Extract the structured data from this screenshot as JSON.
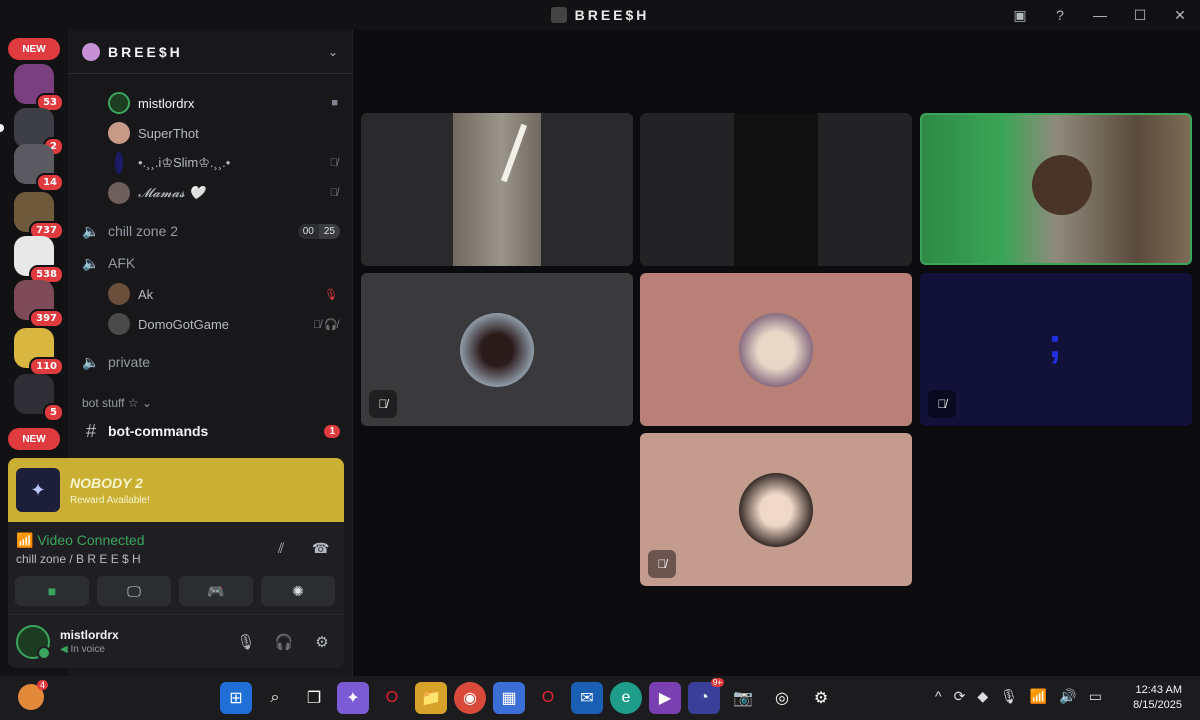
{
  "window": {
    "title": "BREE$H",
    "controls": [
      "inbox-icon",
      "help-icon",
      "minimize-icon",
      "maximize-icon",
      "close-icon"
    ]
  },
  "servers": [
    {
      "badge": "53",
      "color": "#7a3f7f"
    },
    {
      "badge": "2",
      "color": "#3e3e46"
    },
    {
      "badge": "14",
      "color": "#5a5a60"
    },
    {
      "badge": "737",
      "color": "#6e5a3a"
    },
    {
      "badge": "538",
      "color": "#e8e8e8"
    },
    {
      "badge": "397",
      "color": "#7e4a58"
    },
    {
      "badge": "110",
      "color": "#d9b640"
    },
    {
      "badge": "5",
      "color": "#2e2e34"
    }
  ],
  "new_label": "NEW",
  "guild": {
    "name": "BREE$H"
  },
  "voice_users_top": [
    {
      "name": "mistlordrx",
      "status": "camera-icon",
      "color": "#1c3d22"
    },
    {
      "name": "SuperThot",
      "status": "",
      "color": "#c79a87"
    },
    {
      "name": "•.¸¸.i♔Slim♔.¸¸.•",
      "status": "mic-off-icon",
      "color": "#1a1a66"
    },
    {
      "name": "𝓜𝓪𝓶𝓪𝓼 🤍",
      "status": "mic-off-icon",
      "color": "#6e5e5c"
    }
  ],
  "channels": {
    "chill_zone_2": {
      "name": "chill zone 2",
      "count_current": "00",
      "count_limit": "25"
    },
    "afk": {
      "name": "AFK"
    },
    "afk_users": [
      {
        "name": "Ak",
        "status": "mic-muted-red-icon",
        "color": "#6a4e3a"
      },
      {
        "name": "DomoGotGame",
        "status": "deafened-icon",
        "color": "#4a4a4a"
      }
    ],
    "private": {
      "name": "private"
    },
    "category": "bot stuff ☆ ⌄",
    "bot_commands": {
      "name": "bot-commands",
      "unread": "1"
    }
  },
  "reward": {
    "title": "NOBODY 2",
    "subtitle": "Reward Available!"
  },
  "voice_panel": {
    "status": "Video Connected",
    "location": "chill zone / B R E E $ H",
    "buttons": [
      "camera",
      "screen-share",
      "activity",
      "soundboard"
    ]
  },
  "user": {
    "name": "mistlordrx",
    "status": "In voice"
  },
  "tiles": [
    {
      "kind": "video-dark",
      "color": "#2a2a2c"
    },
    {
      "kind": "video-dark",
      "color": "#232325"
    },
    {
      "kind": "video-live",
      "color": "#5f8a55"
    },
    {
      "kind": "avatar",
      "color": "#3a3a3c",
      "avatar_color": "#4a4a52",
      "muted": true
    },
    {
      "kind": "avatar",
      "color": "#b98077",
      "avatar_color": "#a8776a",
      "muted": false
    },
    {
      "kind": "avatar",
      "color": "#11113a",
      "avatar_color": "#1a1ab8",
      "muted": true
    },
    {
      "kind": "avatar",
      "color": "#c39c8e",
      "avatar_color": "#3a2e2a",
      "muted": true
    }
  ],
  "taskbar": {
    "time": "12:43 AM",
    "date": "8/15/2025",
    "discord_badge": "9+",
    "tray_badge": "4"
  }
}
